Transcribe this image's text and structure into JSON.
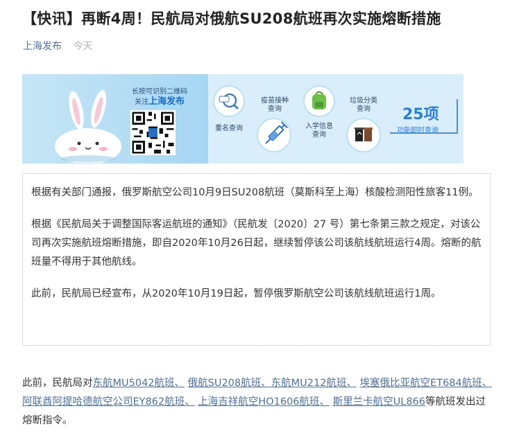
{
  "article": {
    "title": "【快讯】再断4周！民航局对俄航SU208航班再次实施熔断措施",
    "source": "上海发布",
    "date": "今天"
  },
  "banner": {
    "scan_line1": "长按可识别二维码",
    "scan_line2_prefix": "关注",
    "scan_brand": "上海发布",
    "services": [
      {
        "label": "重名查询",
        "icon": "magnifier-icon"
      },
      {
        "label": "疫苗接种\n查询",
        "icon": "syringe-icon"
      },
      {
        "label": "入学信息\n查询",
        "icon": "backpack-icon"
      },
      {
        "label": "垃圾分类\n查询",
        "icon": "trash-bins-icon"
      }
    ],
    "count": "25项",
    "count_sub": "功能即时查询"
  },
  "notice": {
    "paragraphs": [
      "根据有关部门通报，俄罗斯航空公司10月9日SU208航班（莫斯科至上海）核酸检测阳性旅客11例。",
      "根据《民航局关于调整国际客运航班的通知》（民航发〔2020〕27 号）第七条第三款之规定，对该公司再次实施航班熔断措施，即自2020年10月26日起，继续暂停该公司该航线航班运行4周。熔断的航班量不得用于其他航线。",
      "此前，民航局已经宣布，从2020年10月19日起，暂停俄罗斯航空公司该航线航班运行1周。"
    ]
  },
  "footer": {
    "prefix": "此前，民航局对",
    "links": [
      "东航MU5042航班、",
      "俄航SU208航班、",
      "东航MU212航班、",
      "埃塞俄比亚航空ET684航班、",
      "阿联酋阿提哈德航空公司EY862航班、",
      "上海吉祥航空HO1606航班、",
      "斯里兰卡航空UL866"
    ],
    "suffix": "等航班发出过熔断指令。"
  },
  "colors": {
    "link": "#4f6f93",
    "banner_blue": "#2c7ed0"
  }
}
